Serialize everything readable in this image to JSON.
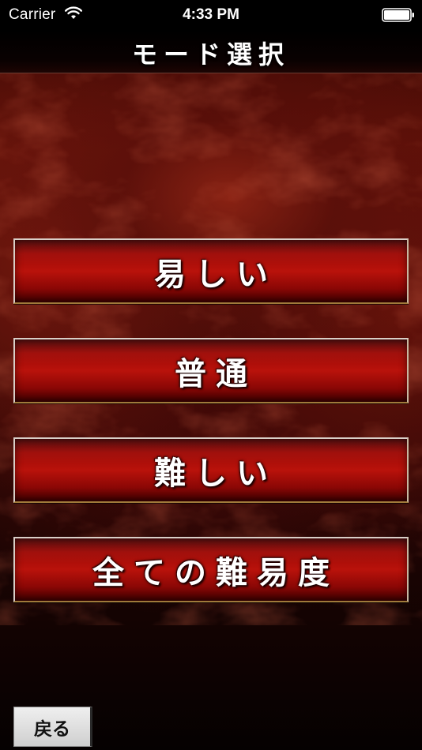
{
  "status_bar": {
    "carrier": "Carrier",
    "time": "4:33 PM",
    "wifi_icon": "wifi-icon",
    "battery_icon": "battery-icon"
  },
  "nav": {
    "title": "モード選択"
  },
  "mode_buttons": [
    {
      "label": "易しい"
    },
    {
      "label": "普通"
    },
    {
      "label": "難しい"
    },
    {
      "label": "全ての難易度"
    }
  ],
  "back_button": {
    "label": "戻る"
  },
  "colors": {
    "button_red": "#b9120b",
    "background_dark": "#1a0403",
    "button_border": "#d9cfc8",
    "back_button_bg": "#e6e6e6"
  }
}
